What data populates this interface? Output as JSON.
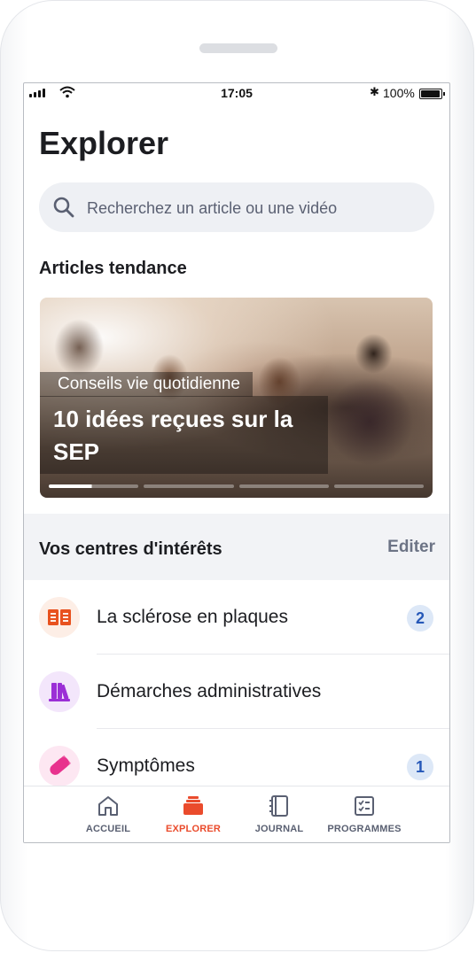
{
  "status_bar": {
    "time": "17:05",
    "battery_percent": "100%",
    "bluetooth_icon": "bluetooth-icon",
    "wifi_icon": "wifi-icon",
    "signal_icon": "cellular-signal-icon"
  },
  "page": {
    "title": "Explorer"
  },
  "search": {
    "placeholder": "Recherchez un article ou une vidéo",
    "icon": "search-icon"
  },
  "trending": {
    "heading": "Articles tendance",
    "featured": {
      "category": "Conseils vie quotidienne",
      "title": "10 idées reçues sur la SEP",
      "slides_total": 4,
      "active_slide": 1,
      "active_progress": 0.48
    }
  },
  "interests": {
    "heading": "Vos centres d'intérêts",
    "edit_label": "Editer",
    "items": [
      {
        "label": "La sclérose en plaques",
        "icon": "open-book-icon",
        "badge": "2",
        "color": "#e8521f",
        "bg": "#fdeee6"
      },
      {
        "label": "Démarches administratives",
        "icon": "books-on-shelf-icon",
        "badge": "",
        "color": "#9b2fd6",
        "bg": "#f3e6fb"
      },
      {
        "label": "Symptômes",
        "icon": "pill-icon",
        "badge": "1",
        "color": "#e8328e",
        "bg": "#fde7f2"
      }
    ]
  },
  "tabbar": {
    "tabs": [
      {
        "label": "ACCUEIL",
        "icon": "home-icon",
        "active": false
      },
      {
        "label": "EXPLORER",
        "icon": "stack-icon",
        "active": true
      },
      {
        "label": "JOURNAL",
        "icon": "notebook-icon",
        "active": false
      },
      {
        "label": "PROGRAMMES",
        "icon": "checklist-icon",
        "active": false
      }
    ]
  },
  "colors": {
    "accent": "#ea4b2c",
    "badge_bg": "#dde8f7",
    "badge_text": "#2658b8",
    "section_bg": "#f2f3f6"
  }
}
